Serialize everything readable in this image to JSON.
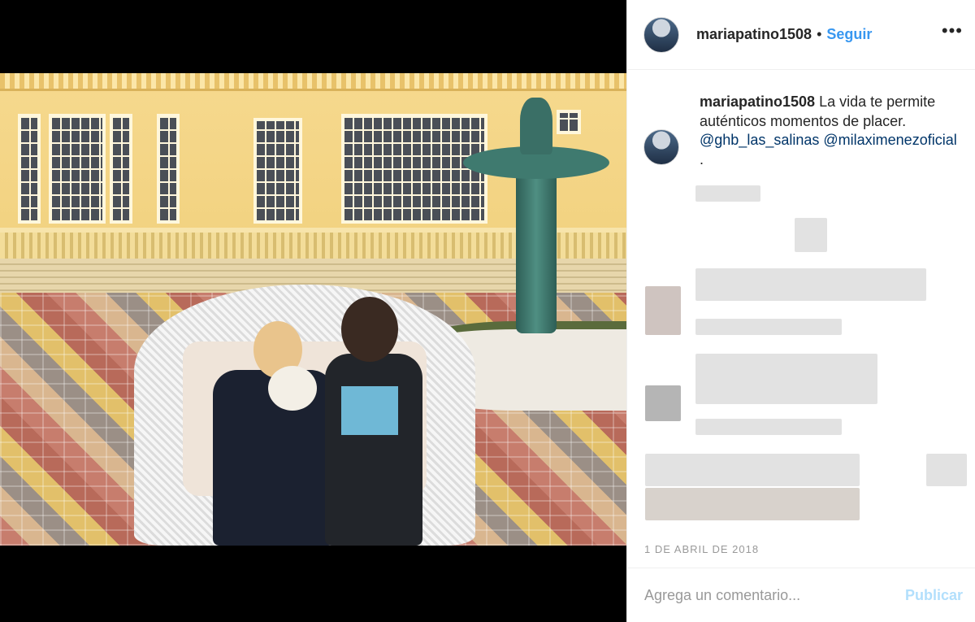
{
  "post": {
    "username": "mariapatino1508",
    "separator": "•",
    "follow_label": "Seguir",
    "more_label": "•••",
    "caption": {
      "username": "mariapatino1508",
      "text": " La vida te permite auténticos momentos de placer. ",
      "mention1": "@ghb_las_salinas",
      "mention2": "@milaximenezoficial",
      "trailing": "."
    },
    "date": "1 DE ABRIL DE 2018",
    "comment_placeholder": "Agrega un comentario...",
    "publish_label": "Publicar"
  },
  "colors": {
    "accent": "#3897f0",
    "publish_disabled": "#b2dffc",
    "muted": "#999999"
  }
}
